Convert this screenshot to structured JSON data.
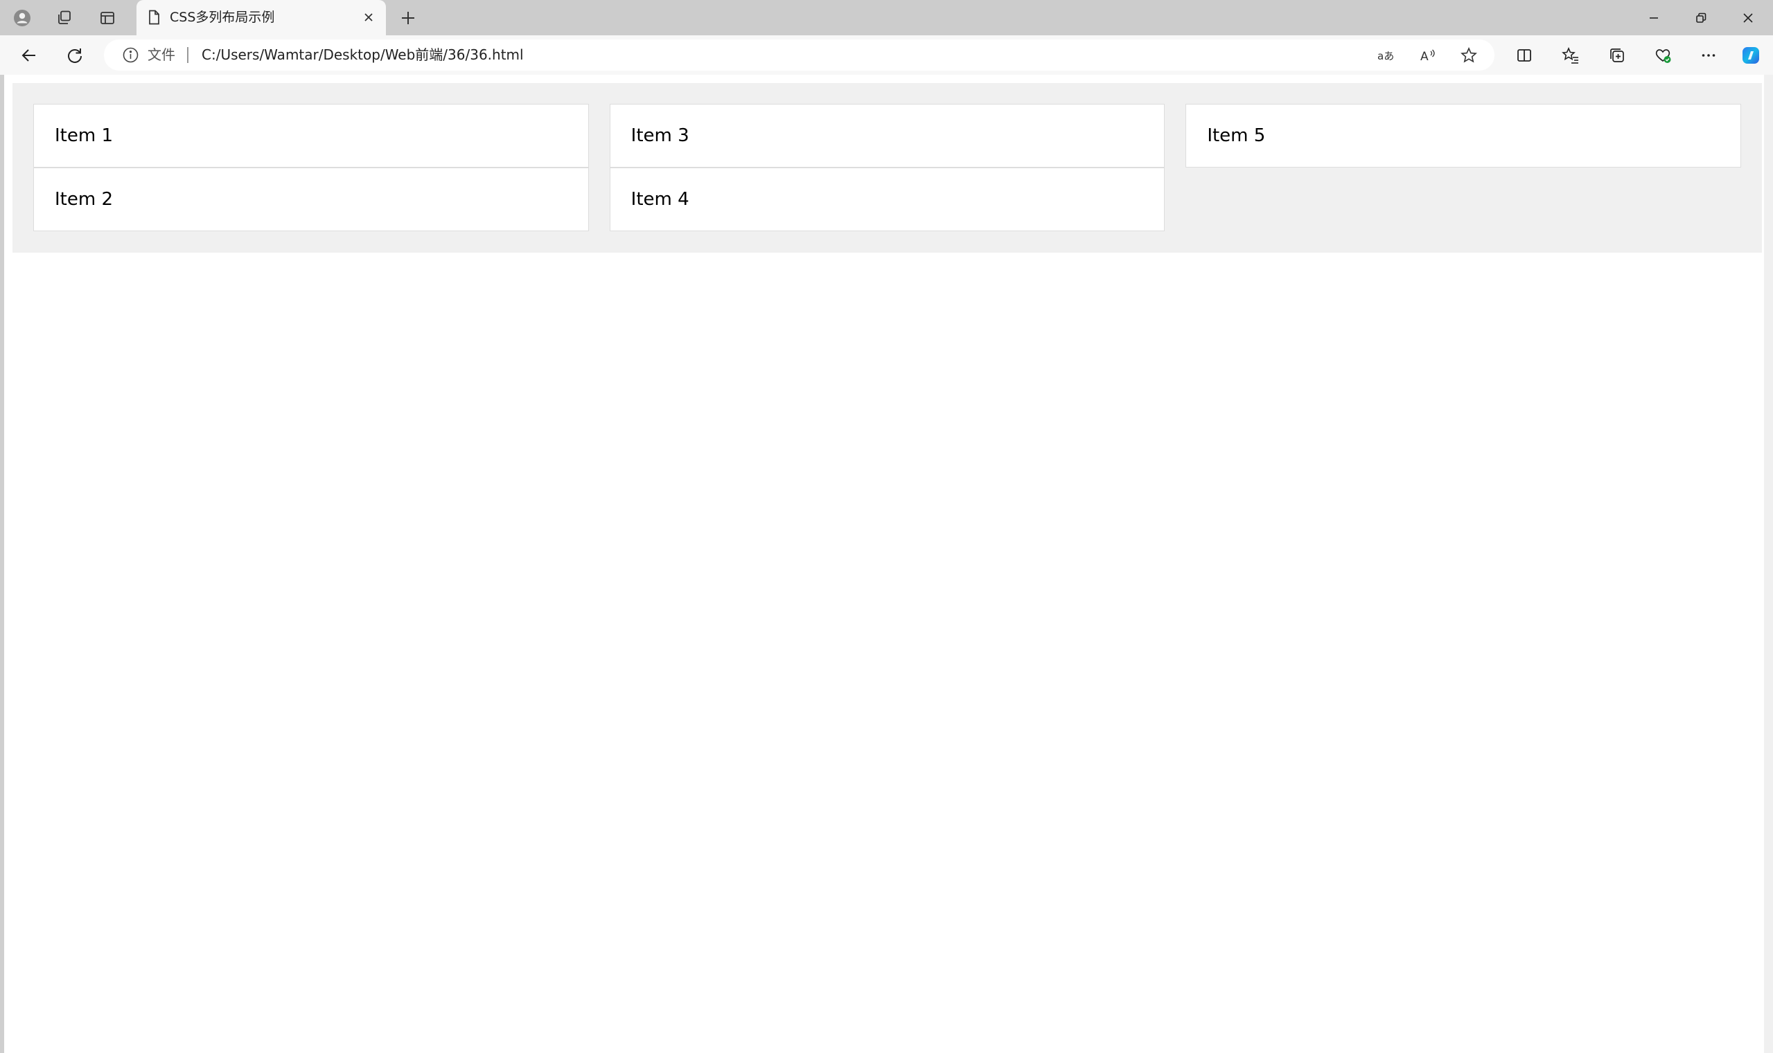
{
  "browser": {
    "tab": {
      "title": "CSS多列布局示例"
    },
    "address_bar": {
      "scheme_label": "文件",
      "url": "C:/Users/Wamtar/Desktop/Web前端/36/36.html"
    },
    "icons": {
      "profile": "profile-icon",
      "workspaces": "workspaces-icon",
      "vertical_tabs": "vertical-tabs-icon",
      "page": "page-icon",
      "close": "close-icon",
      "new_tab": "plus-icon",
      "minimize": "minimize-icon",
      "restore": "restore-icon",
      "back": "back-arrow-icon",
      "refresh": "refresh-icon",
      "info": "info-icon",
      "translate": "translate-icon",
      "read_aloud": "read-aloud-icon",
      "favorite": "star-icon",
      "split": "split-screen-icon",
      "favorites": "favorites-icon",
      "collections": "collections-icon",
      "browser_essentials": "heart-shield-icon",
      "more": "more-icon",
      "copilot": "copilot-icon"
    }
  },
  "page": {
    "items": [
      {
        "label": "Item 1"
      },
      {
        "label": "Item 2"
      },
      {
        "label": "Item 3"
      },
      {
        "label": "Item 4"
      },
      {
        "label": "Item 5"
      }
    ]
  },
  "colors": {
    "container_bg": "#f0f0f0",
    "item_bg": "#ffffff",
    "item_border": "#dddddd",
    "tabstrip_bg": "#cccccc",
    "toolbar_bg": "#f7f7f7"
  }
}
